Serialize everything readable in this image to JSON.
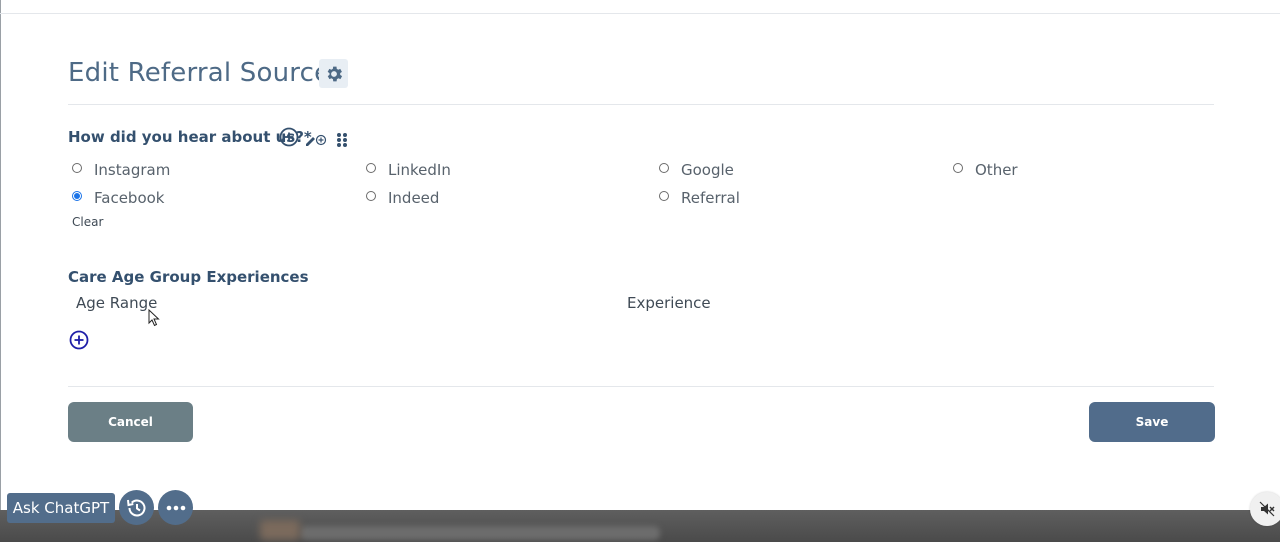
{
  "page": {
    "title": "Edit Referral Source"
  },
  "referral_question": {
    "label": "How did you hear about us?*",
    "options": [
      {
        "label": "Instagram",
        "checked": false
      },
      {
        "label": "LinkedIn",
        "checked": false
      },
      {
        "label": "Google",
        "checked": false
      },
      {
        "label": "Other",
        "checked": false
      },
      {
        "label": "Facebook",
        "checked": true
      },
      {
        "label": "Indeed",
        "checked": false
      },
      {
        "label": "Referral",
        "checked": false
      }
    ],
    "selected": "Facebook",
    "clear_label": "Clear"
  },
  "age_group_section": {
    "label": "Care Age Group Experiences",
    "columns": [
      "Age Range",
      "Experience"
    ]
  },
  "actions": {
    "cancel_label": "Cancel",
    "save_label": "Save"
  },
  "assistant_bar": {
    "ask_label": "Ask ChatGPT"
  },
  "icons": {
    "settings": "gear-icon",
    "add": "add-circle-icon",
    "edit_add": "edit-add-icon",
    "drag": "drag-handle-icon",
    "history": "history-icon",
    "more": "more-horizontal-icon",
    "mute": "volume-mute-icon",
    "cursor": "mouse-pointer-icon"
  },
  "colors": {
    "title": "#4e6a86",
    "label": "#34506e",
    "radio_checked": "#1a73e8",
    "cancel_button": "#6b7f86",
    "save_button": "#516c8b",
    "assistant_button": "#526d8b",
    "add_icon": "#1f1fa8"
  }
}
